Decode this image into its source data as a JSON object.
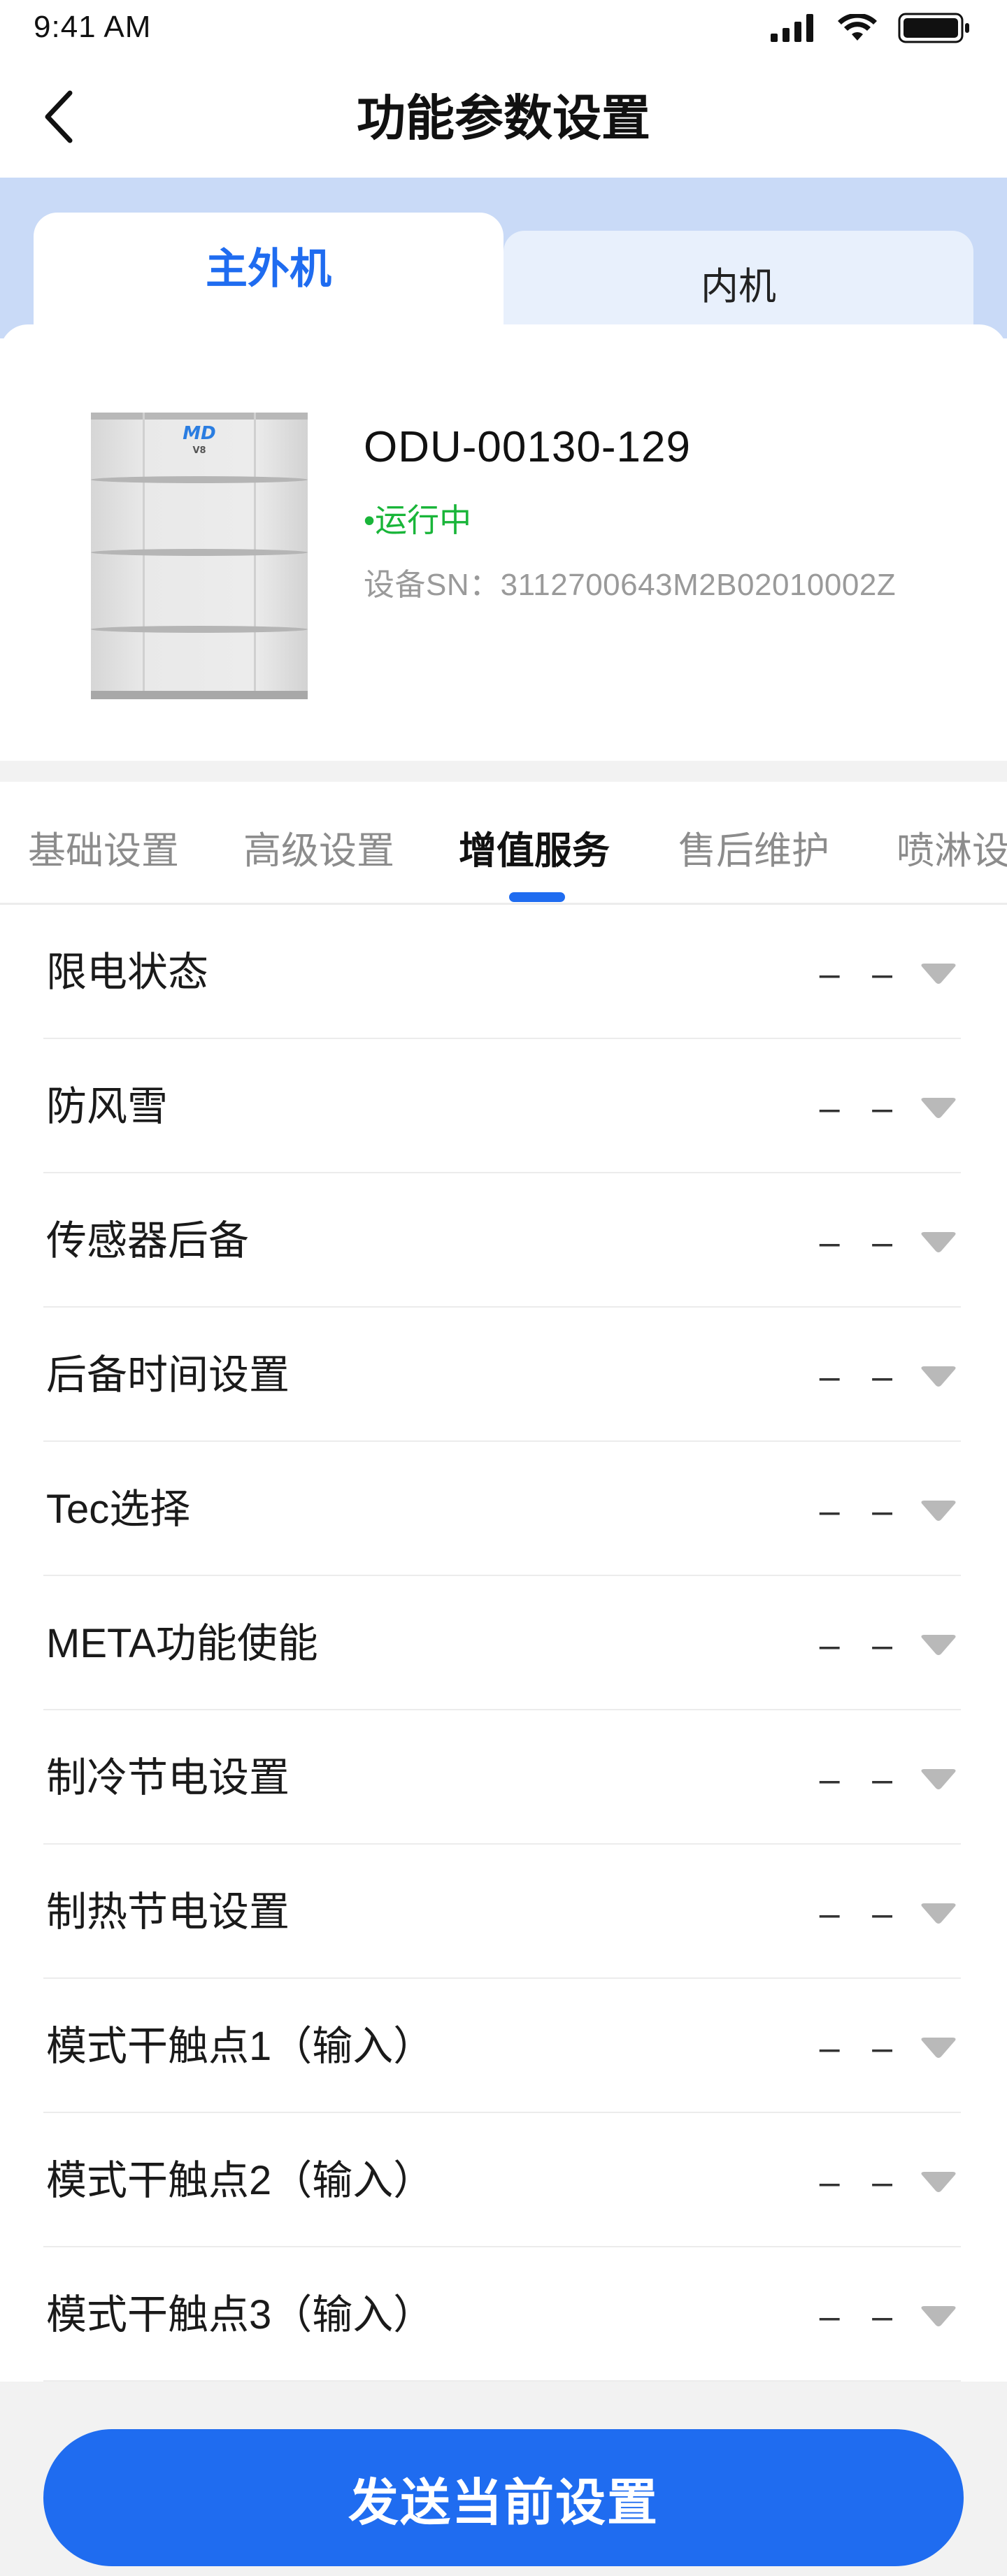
{
  "status_bar": {
    "time": "9:41 AM"
  },
  "nav": {
    "title": "功能参数设置",
    "back_icon": "chevron-left-icon"
  },
  "unit_tabs": [
    {
      "label": "主外机",
      "active": true
    },
    {
      "label": "内机",
      "active": false
    }
  ],
  "device": {
    "name": "ODU-00130-129",
    "status": "•运行中",
    "sn": "设备SN：3112700643M2B02010002Z",
    "logo_text": "V8"
  },
  "category_tabs": [
    {
      "label": "基础设置",
      "active": false
    },
    {
      "label": "高级设置",
      "active": false
    },
    {
      "label": "增值服务",
      "active": true
    },
    {
      "label": "售后维护",
      "active": false
    },
    {
      "label": "喷淋设",
      "active": false
    }
  ],
  "settings": [
    {
      "label": "限电状态",
      "value": "– –"
    },
    {
      "label": "防风雪",
      "value": "– –"
    },
    {
      "label": "传感器后备",
      "value": "– –"
    },
    {
      "label": "后备时间设置",
      "value": "– –"
    },
    {
      "label": "Tec选择",
      "value": "– –"
    },
    {
      "label": "META功能使能",
      "value": "– –"
    },
    {
      "label": "制冷节电设置",
      "value": "– –"
    },
    {
      "label": "制热节电设置",
      "value": "– –"
    },
    {
      "label": "模式干触点1（输入）",
      "value": "– –"
    },
    {
      "label": "模式干触点2（输入）",
      "value": "– –"
    },
    {
      "label": "模式干触点3（输入）",
      "value": "– –"
    }
  ],
  "footer": {
    "send_label": "发送当前设置"
  },
  "colors": {
    "accent": "#1f6cf0",
    "status_running": "#19b539",
    "header_band": "#c9daf7"
  }
}
